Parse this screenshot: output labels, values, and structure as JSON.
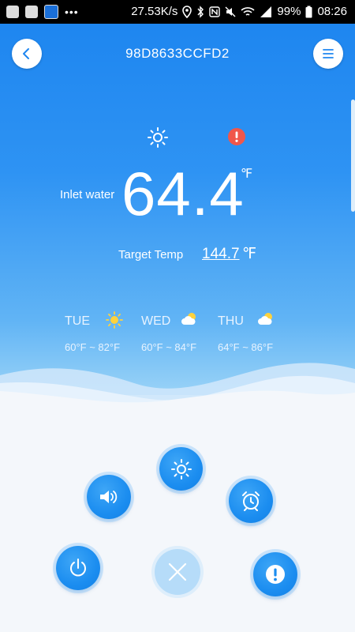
{
  "status_bar": {
    "net_speed": "27.53K/s",
    "battery": "99%",
    "time": "08:26"
  },
  "header": {
    "device_id": "98D8633CCFD2",
    "back_icon": "chevron-left-icon",
    "menu_icon": "menu-icon"
  },
  "status_icons": {
    "sun": "sun-icon",
    "alert": "alert-icon"
  },
  "temperature": {
    "label": "Inlet water",
    "value": "64.4",
    "unit": "℉"
  },
  "target": {
    "label": "Target Temp",
    "value": "144.7",
    "unit": "℉"
  },
  "forecast": [
    {
      "day": "TUE",
      "icon": "sun-icon",
      "range": "60°F ~ 82°F"
    },
    {
      "day": "WED",
      "icon": "partly-cloudy-icon",
      "range": "60°F ~ 84°F"
    },
    {
      "day": "THU",
      "icon": "partly-cloudy-icon",
      "range": "64°F ~ 86°F"
    }
  ],
  "controls": [
    {
      "name": "sound",
      "icon": "speaker-icon"
    },
    {
      "name": "mode",
      "icon": "sun-icon"
    },
    {
      "name": "timer",
      "icon": "alarm-clock-icon"
    },
    {
      "name": "power",
      "icon": "power-icon"
    },
    {
      "name": "close",
      "icon": "close-icon"
    },
    {
      "name": "alert",
      "icon": "alert-icon"
    }
  ],
  "colors": {
    "accent": "#1e86f0",
    "alert": "#f0574b"
  }
}
